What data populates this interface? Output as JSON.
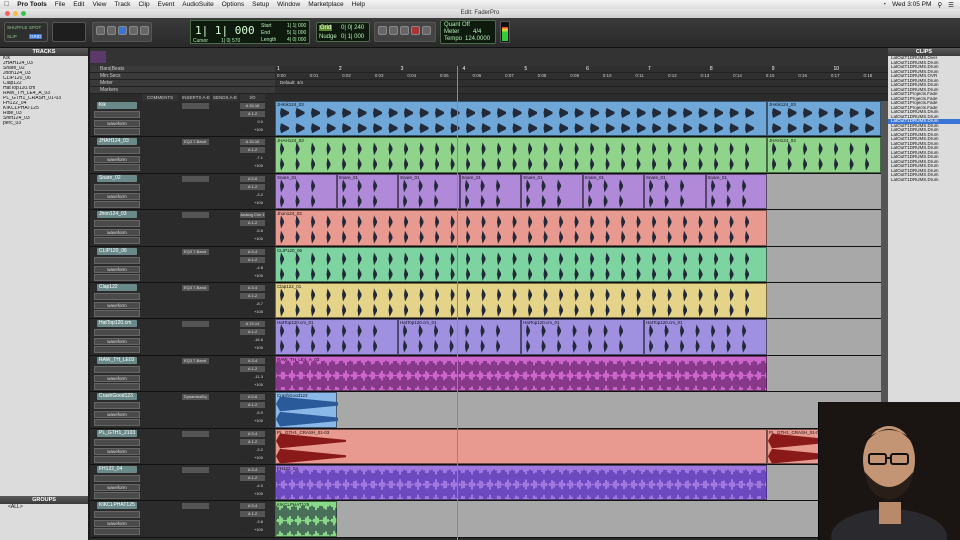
{
  "menubar": {
    "app": "Pro Tools",
    "items": [
      "File",
      "Edit",
      "View",
      "Track",
      "Clip",
      "Event",
      "AudioSuite",
      "Options",
      "Setup",
      "Window",
      "Marketplace",
      "Help"
    ],
    "clock": "Wed 3:05 PM"
  },
  "window": {
    "title": "Edit: FaderPro"
  },
  "toolbar": {
    "counter": "1| 1| 000",
    "start": "1| 1| 000",
    "end": "5| 1| 000",
    "length": "4| 0| 000",
    "start_label": "Start",
    "end_label": "End",
    "length_label": "Length",
    "cursor_label": "Cursor",
    "cursor": "1| 0| 570",
    "nudge_label": "Nudge",
    "nudge": "0| 1| 000",
    "grid": "0| 0| 240",
    "grid_label": "Grid",
    "tempo_label": "Tempo",
    "tempo": "124.0000",
    "meter": "4/4",
    "meter_label": "Meter",
    "quantize": "Quant Off",
    "shuffle": "SHUFFLE",
    "spot": "SPOT",
    "slip": "SLIP",
    "grid_mode": "GRID"
  },
  "panels": {
    "tracks": "TRACKS",
    "groups": "GROUPS",
    "clips": "CLIPS",
    "groups_item": "<ALL>"
  },
  "track_list": [
    "Kik",
    "JHAH124_03",
    "Snare_02",
    "Jhon124_03",
    "CLIP120_06",
    "Clap122",
    "HatTop120.cm",
    "RAW_TH_LE4_A_03",
    "PL_GTH1_CRASH_01-03",
    "FH122_04",
    "KIKCLPHAT125",
    "Ride_03",
    "Shift124_03",
    "perc_03"
  ],
  "clips_list": [
    "LatOutT1DRUMS.Over",
    "LatOutT1DRUMS.Drum",
    "LatOutT1DRUMS.Drum",
    "LatOutT1DRUMS.Drum",
    "LatOutT1DRUMS.OVR",
    "LatOutT1DRUMS.Drum",
    "LatOutT1DRUMS.Drum",
    "LatOutT1DRUMS.Drum",
    "LatOutT1Projects.Fade",
    "LatOutT1Projects.Fade",
    "LatOutT1Projects.Fade",
    "LatOutT1Projects.Fade",
    "LatOutT1DRUMS.Drum",
    "LatOutT1DRUMS.Drum",
    "LatOutT1DRUMS.Drum",
    "LatOutT1DRUMS.Drum",
    "LatOutT1DRUMS.Drum",
    "LatOutT1DRUMS.Drum",
    "LatOutT1DRUMS.Drum",
    "LatOutT1DRUMS.Drum",
    "LatOutT1DRUMS.Drum",
    "LatOutT1DRUMS.Drum",
    "LatOutT1DRUMS.Drum",
    "LatOutT1DRUMS.Drum",
    "LatOutT1DRUMS.Drum",
    "LatOutT1DRUMS.Drum",
    "LatOutT1DRUMS.Drum",
    "LatOutT1DRUMS.Drum"
  ],
  "rulers": [
    "Bars|Beats",
    "Min:Secs",
    "Meter",
    "Markers"
  ],
  "ruler_bars": [
    "1",
    "2",
    "3",
    "4",
    "5",
    "6",
    "7",
    "8",
    "9",
    "10"
  ],
  "ruler_secs": [
    "0:00",
    "0:01",
    "0:02",
    "0:03",
    "0:04",
    "0:05",
    "0:06",
    "0:07",
    "0:08",
    "0:09",
    "0:10",
    "0:11",
    "0:12",
    "0:13",
    "0:14",
    "0:15",
    "0:16",
    "0:17",
    "0:18"
  ],
  "meter_marker": "Default: 4/4",
  "column_headers": [
    "COMMENTS",
    "INSERTS A-E",
    "SENDS A-E",
    "I/O"
  ],
  "tracks": [
    {
      "name": "Kik",
      "color": "#6fa8d8",
      "clips": [
        "JHKik124_03",
        "JHKik124_03"
      ],
      "insert": "",
      "io_in": "A 15-16",
      "io_out": "A 1-2",
      "vol": "0.0",
      "pan": "+100"
    },
    {
      "name": "JHAH124_03",
      "color": "#8fd48a",
      "clips": [
        "JHAH124_03",
        "JHAH124_03"
      ],
      "insert": "EQ3 7-Band",
      "io_in": "A 15-16",
      "io_out": "A 1-2",
      "vol": "-7.1",
      "pan": "+100"
    },
    {
      "name": "Snare_02",
      "color": "#b08ad8",
      "clips": [
        "Snare_01",
        "Snare_01",
        "Snare_01",
        "Snare_01",
        "Snare_01",
        "Snare_01",
        "Snare_01",
        "Snare_01"
      ],
      "insert": "",
      "io_in": "A 5-6",
      "io_out": "A 1-2",
      "vol": "-3.2",
      "pan": "+100"
    },
    {
      "name": "Jhon124_03",
      "color": "#e89a90",
      "clips": [
        "Jhon124_03"
      ],
      "insert": "",
      "io_in": "Analog Chn 1",
      "io_out": "A 1-2",
      "vol": "-5.6",
      "pan": "+100"
    },
    {
      "name": "CLIP120_06",
      "color": "#7ed4a0",
      "clips": [
        "CLIP120_06"
      ],
      "insert": "EQ3 7-Band",
      "io_in": "A 3-4",
      "io_out": "A 1-2",
      "vol": "-4.8",
      "pan": "+100"
    },
    {
      "name": "Clap122",
      "color": "#e6d38a",
      "clips": [
        "Clap122_01"
      ],
      "insert": "EQ3 7-Band",
      "io_in": "A 3-4",
      "io_out": "A 1-2",
      "vol": "-8.7",
      "pan": "+100"
    },
    {
      "name": "HatTop120.cm",
      "color": "#a090e0",
      "clips": [
        "HatTop120.cm_01",
        "HatTop120.cm_01",
        "HatTop120.cm_01",
        "HatTop120.cm_01"
      ],
      "insert": "",
      "io_in": "A 13-14",
      "io_out": "A 1-2",
      "vol": "-16.6",
      "pan": "+100"
    },
    {
      "name": "RAW_TH_LE03",
      "color": "#cc66cc",
      "clips": [
        "RAW_TH_LE4_A_03"
      ],
      "insert": "EQ3 7-Band",
      "io_in": "A 3-4",
      "io_out": "A 1-2",
      "vol": "-11.3",
      "pan": "+100"
    },
    {
      "name": "CrashGood123",
      "color": "#8ab8e8",
      "clips": [
        "CrashGood123"
      ],
      "insert": "DynamicsEq",
      "io_in": "A 5-6",
      "io_out": "A 1-2",
      "vol": "-5.0",
      "pan": "+100"
    },
    {
      "name": "PL_GTH1_2103",
      "color": "#e89a90",
      "clips": [
        "PL_GTH1_CRASH_01-03",
        "PL_GTH1_CRASH_01-03"
      ],
      "insert": "",
      "io_in": "A 3-4",
      "io_out": "A 1-2",
      "vol": "-3.2",
      "pan": "+100"
    },
    {
      "name": "FH122_04",
      "color": "#a078e0",
      "clips": [
        "FH122_04"
      ],
      "insert": "",
      "io_in": "A 3-4",
      "io_out": "A 1-2",
      "vol": "-4.0",
      "pan": "+100"
    },
    {
      "name": "KIKCLPHAT125",
      "color": "#88d888",
      "clips": [
        "KIKCLPHAT125"
      ],
      "insert": "",
      "io_in": "A 3-4",
      "io_out": "A 1-2",
      "vol": "-3.6",
      "pan": "+100"
    }
  ]
}
